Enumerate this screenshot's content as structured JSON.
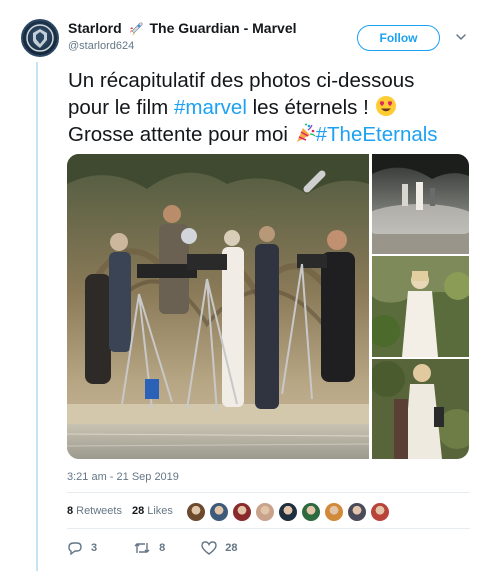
{
  "user": {
    "display_name_part1": "Starlord",
    "display_name_part2": "The Guardian - Marvel",
    "handle": "@starlord624",
    "avatar_icon": "shield-logo-icon",
    "name_emoji_icon": "rocket-icon"
  },
  "follow_label": "Follow",
  "tweet": {
    "line1": "Un récapitulatif des photos ci-dessous",
    "line2_pre": "pour le film ",
    "line2_tag": "#marvel",
    "line2_post": " les éternels ! ",
    "line3_pre": "Grosse attente pour moi ",
    "line3_tag": "#TheEternals",
    "emoji_1": "heart-eyes-emoji",
    "emoji_2": "party-popper-emoji"
  },
  "timestamp": "3:21 am - 21 Sep 2019",
  "stats": {
    "retweets_count": "8",
    "retweets_label": "Retweets",
    "likes_count": "28",
    "likes_label": "Likes"
  },
  "likers": [
    "#6b4a2e",
    "#3c5a7a",
    "#8a2a2a",
    "#c9a28c",
    "#1f2f3f",
    "#2d6a3e",
    "#d08a3a",
    "#4a4a5a",
    "#b8443a"
  ],
  "actions": {
    "reply_count": "3",
    "retweet_count": "8",
    "like_count": "28"
  },
  "colors": {
    "accent": "#1da1f2",
    "secondary_text": "#657786",
    "thread_line": "#c4e3f5"
  }
}
